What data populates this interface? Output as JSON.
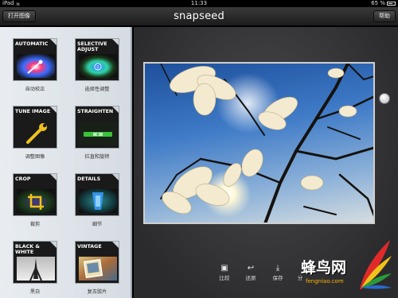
{
  "status": {
    "device": "iPad",
    "time": "11:33",
    "battery": "65 %"
  },
  "nav": {
    "open_label": "打开图像",
    "app_title": "snapseed",
    "help_label": "帮助"
  },
  "filters": [
    {
      "caption": "AUTOMATIC",
      "label": "自动校正"
    },
    {
      "caption": "SELECTIVE ADJUST",
      "label": "选择性调整"
    },
    {
      "caption": "TUNE IMAGE",
      "label": "调整图像"
    },
    {
      "caption": "STRAIGHTEN",
      "label": "拉直和旋转"
    },
    {
      "caption": "CROP",
      "label": "裁剪"
    },
    {
      "caption": "DETAILS",
      "label": "细节"
    },
    {
      "caption": "BLACK & WHITE",
      "label": "黑白"
    },
    {
      "caption": "VINTAGE",
      "label": "复古胶片"
    }
  ],
  "toolbar": {
    "compare": "比较",
    "restore": "还原",
    "save": "保存",
    "share": "分"
  },
  "watermark": {
    "text": "蜂鸟网",
    "url": "fengniao.com"
  },
  "colors": {
    "panel": "#e3e7ec",
    "main_bg": "#3a3a3c",
    "accent_green": "#39c23a",
    "accent_yellow": "#f2c21a",
    "accent_blue": "#3aa0ff"
  }
}
